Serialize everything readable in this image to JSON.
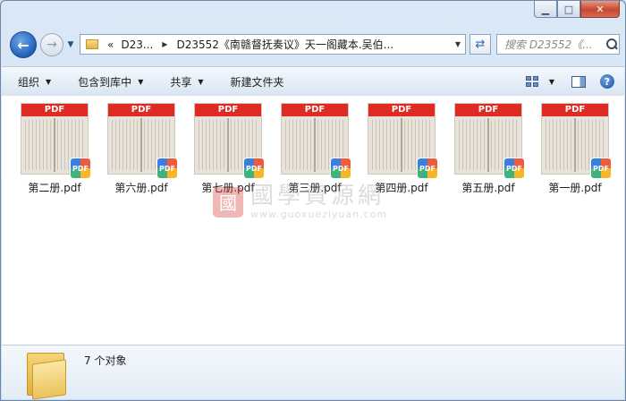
{
  "window": {
    "minimize": "▁",
    "maximize": "□",
    "close": "✕"
  },
  "nav": {
    "back_icon": "back-arrow-icon",
    "forward_icon": "forward-arrow-icon",
    "address_segments": [
      "D23...",
      "D23552《南赣督抚奏议》天一阁藏本.吴伯..."
    ],
    "address_prefix": "«",
    "search_placeholder": "搜索 D23552《..."
  },
  "toolbar": {
    "organize": "组织",
    "include_library": "包含到库中",
    "share": "共享",
    "new_folder": "新建文件夹"
  },
  "files": [
    {
      "name": "第二册.pdf",
      "band": "PDF",
      "badge": "PDF"
    },
    {
      "name": "第六册.pdf",
      "band": "PDF",
      "badge": "PDF"
    },
    {
      "name": "第七册.pdf",
      "band": "PDF",
      "badge": "PDF"
    },
    {
      "name": "第三册.pdf",
      "band": "PDF",
      "badge": "PDF"
    },
    {
      "name": "第四册.pdf",
      "band": "PDF",
      "badge": "PDF"
    },
    {
      "name": "第五册.pdf",
      "band": "PDF",
      "badge": "PDF"
    },
    {
      "name": "第一册.pdf",
      "band": "PDF",
      "badge": "PDF"
    }
  ],
  "watermark": {
    "seal": "國",
    "title": "國學資源網",
    "url": "www.guoxueziyuan.com"
  },
  "status": {
    "count_text": "7 个对象"
  }
}
